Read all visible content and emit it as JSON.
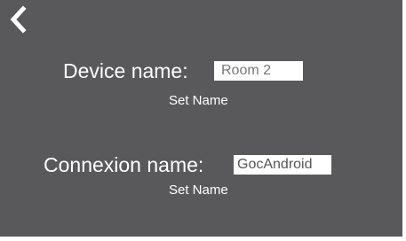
{
  "nav": {
    "back_icon": "chevron-left-icon"
  },
  "device": {
    "label": "Device name:",
    "value": "Room 2",
    "set_label": "Set Name"
  },
  "connexion": {
    "label": "Connexion name:",
    "value": "GocAndroid",
    "set_label": "Set Name"
  },
  "colors": {
    "background": "#59595b",
    "text": "#ffffff",
    "input_background": "#ffffff"
  }
}
